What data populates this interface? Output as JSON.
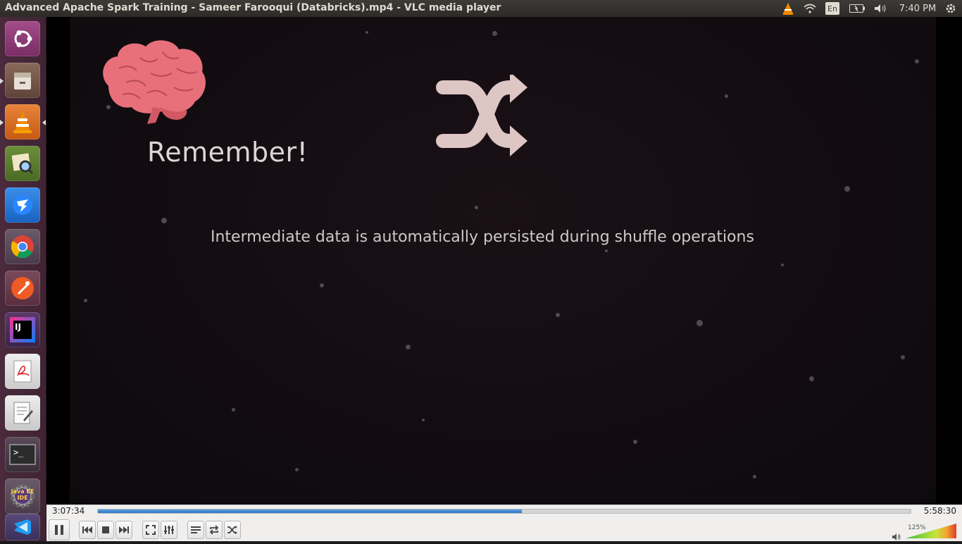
{
  "window": {
    "title": "Advanced Apache Spark Training - Sameer Farooqui (Databricks).mp4 - VLC media player"
  },
  "tray": {
    "language": "En",
    "clock": "7:40 PM"
  },
  "launcher": {
    "items": [
      {
        "name": "ubuntu-dash",
        "label": ""
      },
      {
        "name": "files",
        "label": ""
      },
      {
        "name": "vlc",
        "label": ""
      },
      {
        "name": "image-viewer",
        "label": ""
      },
      {
        "name": "dingtalk",
        "label": ""
      },
      {
        "name": "chrome",
        "label": ""
      },
      {
        "name": "postman",
        "label": ""
      },
      {
        "name": "intellij",
        "label": "IJ"
      },
      {
        "name": "pdf-reader",
        "label": ""
      },
      {
        "name": "text-editor",
        "label": ""
      },
      {
        "name": "terminal",
        "label": ">_"
      },
      {
        "name": "eclipse-javaee",
        "label": "Java EE IDE"
      },
      {
        "name": "vscode",
        "label": ""
      }
    ]
  },
  "video": {
    "heading": "Remember!",
    "caption": "Intermediate data is automatically persisted during shuffle operations"
  },
  "playback": {
    "elapsed": "3:07:34",
    "total": "5:58:30",
    "progress_fraction": 0.522,
    "volume_label": "125%",
    "volume_fraction": 1.0
  },
  "colors": {
    "brain": "#e8707a",
    "seek": "#2f78c8",
    "launcher": "#4a2a3c"
  }
}
